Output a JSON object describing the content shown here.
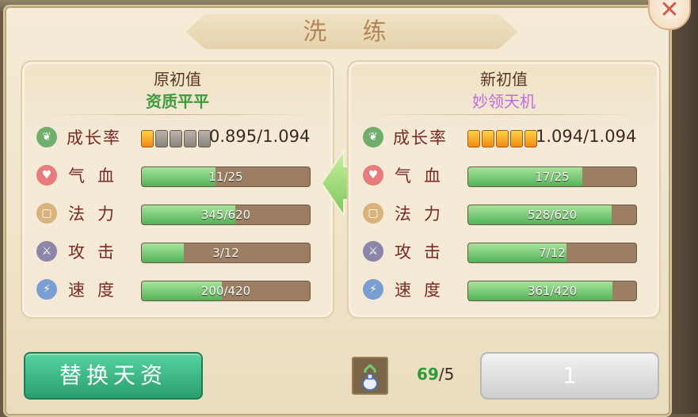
{
  "title": "洗 练",
  "close": {
    "label": "✕"
  },
  "left": {
    "header": "原初值",
    "subtitle": "资质平平",
    "growth": {
      "label": "成长率",
      "value_text": "0.895/1.094",
      "pips_on": 1,
      "pips_total": 5
    },
    "stats": [
      {
        "key": "hp",
        "label": "气血",
        "value": 11,
        "max": 25,
        "text": "11/25"
      },
      {
        "key": "mp",
        "label": "法力",
        "value": 345,
        "max": 620,
        "text": "345/620"
      },
      {
        "key": "atk",
        "label": "攻击",
        "value": 3,
        "max": 12,
        "text": "3/12"
      },
      {
        "key": "spd",
        "label": "速度",
        "value": 200,
        "max": 420,
        "text": "200/420"
      }
    ]
  },
  "right": {
    "header": "新初值",
    "subtitle": "妙领天机",
    "growth": {
      "label": "成长率",
      "value_text": "1.094/1.094",
      "pips_on": 5,
      "pips_total": 5
    },
    "stats": [
      {
        "key": "hp",
        "label": "气血",
        "value": 17,
        "max": 25,
        "text": "17/25"
      },
      {
        "key": "mp",
        "label": "法力",
        "value": 528,
        "max": 620,
        "text": "528/620"
      },
      {
        "key": "atk",
        "label": "攻击",
        "value": 7,
        "max": 12,
        "text": "7/12"
      },
      {
        "key": "spd",
        "label": "速度",
        "value": 361,
        "max": 420,
        "text": "361/420"
      }
    ]
  },
  "buttons": {
    "replace": "替换天资",
    "refine": "1"
  },
  "item": {
    "icon": "potion-vase-icon",
    "have": "69",
    "need": "/5"
  },
  "colors": {
    "bar_fill": "#54b25a",
    "pip_on": "#f08a12",
    "replace_btn": "#2a9f6e"
  }
}
